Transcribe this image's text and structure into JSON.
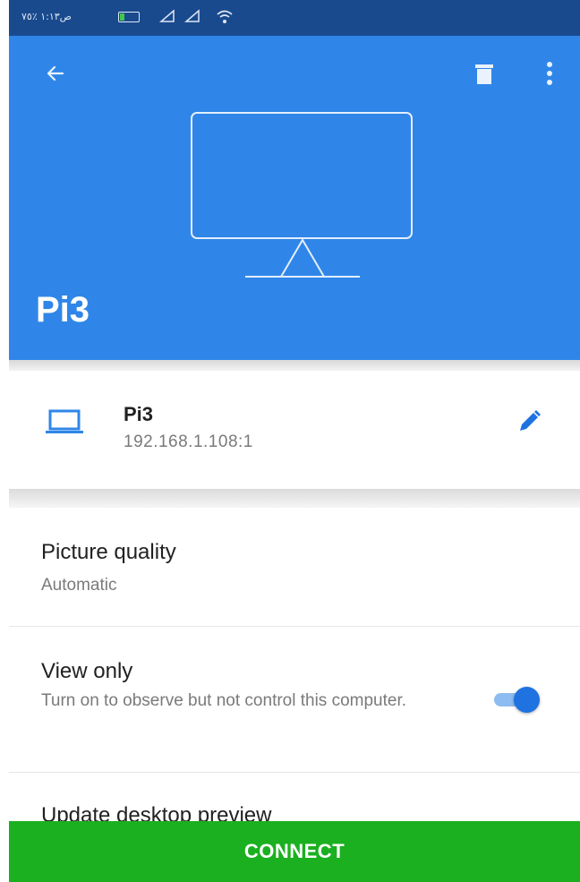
{
  "status_bar": {
    "left_text": "ص١:١٣  ٪٧٥",
    "icons": [
      "battery-icon",
      "signal-icon",
      "signal-icon",
      "wifi-icon"
    ]
  },
  "app_bar": {
    "icons": {
      "back": "arrow-left",
      "delete": "trash",
      "more": "vertical-ellipsis"
    },
    "title": "Pi3"
  },
  "computer": {
    "name": "Pi3",
    "address": "192.168.1.108:1",
    "icons": {
      "device": "laptop",
      "edit": "pencil"
    }
  },
  "settings": {
    "picture_quality": {
      "title": "Picture quality",
      "value": "Automatic"
    },
    "view_only": {
      "title": "View only",
      "description": "Turn on to observe but not control this computer.",
      "enabled": true
    },
    "update_preview": {
      "title": "Update desktop preview"
    }
  },
  "actions": {
    "connect_label": "CONNECT"
  },
  "colors": {
    "status_bar": "#1a4a8e",
    "app_bar": "#2f86e8",
    "accent": "#1e73e0",
    "connect": "#1bb01f"
  }
}
